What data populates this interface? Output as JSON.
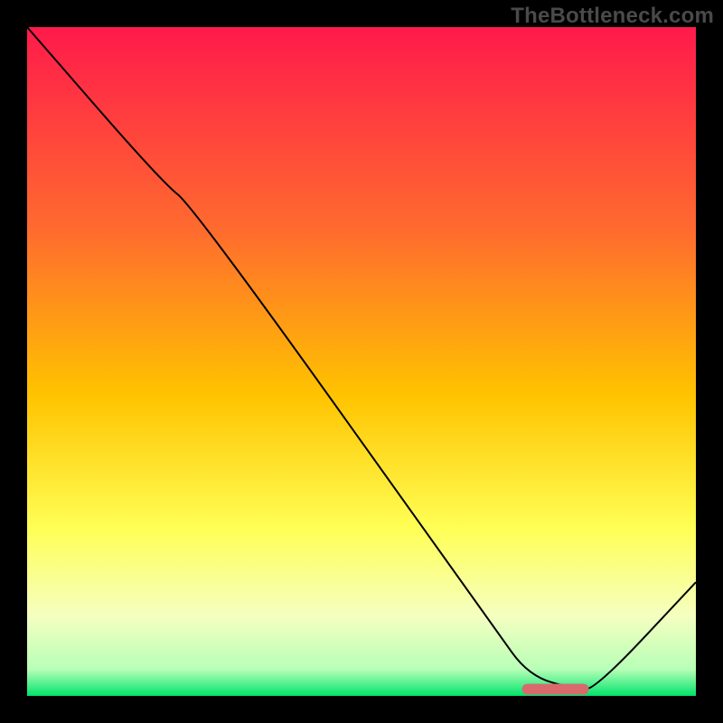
{
  "watermark": "TheBottleneck.com",
  "colors": {
    "gradient_top": "#ff1a4b",
    "gradient_mid1": "#ff7a2f",
    "gradient_mid2": "#ffd400",
    "gradient_mid3": "#ffff66",
    "gradient_mid4": "#f6ffb0",
    "gradient_bottom": "#00e36b",
    "curve": "#000000",
    "marker": "#d86a6c",
    "frame_bg": "#000000"
  },
  "chart_data": {
    "type": "line",
    "title": "",
    "xlabel": "",
    "ylabel": "",
    "xlim": [
      0,
      100
    ],
    "ylim": [
      0,
      100
    ],
    "series": [
      {
        "name": "bottleneck-curve",
        "x": [
          0,
          20,
          25,
          70,
          75,
          82,
          85,
          100
        ],
        "values": [
          100,
          77,
          73,
          10,
          3,
          1,
          1,
          17
        ]
      }
    ],
    "annotations": [
      {
        "type": "marker",
        "shape": "rounded-bar",
        "name": "optimal-range",
        "x_range": [
          74,
          84
        ],
        "y": 1,
        "color": "#d86a6c"
      }
    ],
    "background": {
      "type": "vertical-gradient",
      "stops": [
        {
          "pos": 0.0,
          "color": "#ff1a4b"
        },
        {
          "pos": 0.3,
          "color": "#ff6a2f"
        },
        {
          "pos": 0.55,
          "color": "#ffc300"
        },
        {
          "pos": 0.75,
          "color": "#ffff55"
        },
        {
          "pos": 0.88,
          "color": "#f5ffc0"
        },
        {
          "pos": 0.96,
          "color": "#b8ffb8"
        },
        {
          "pos": 1.0,
          "color": "#00e36b"
        }
      ]
    }
  }
}
